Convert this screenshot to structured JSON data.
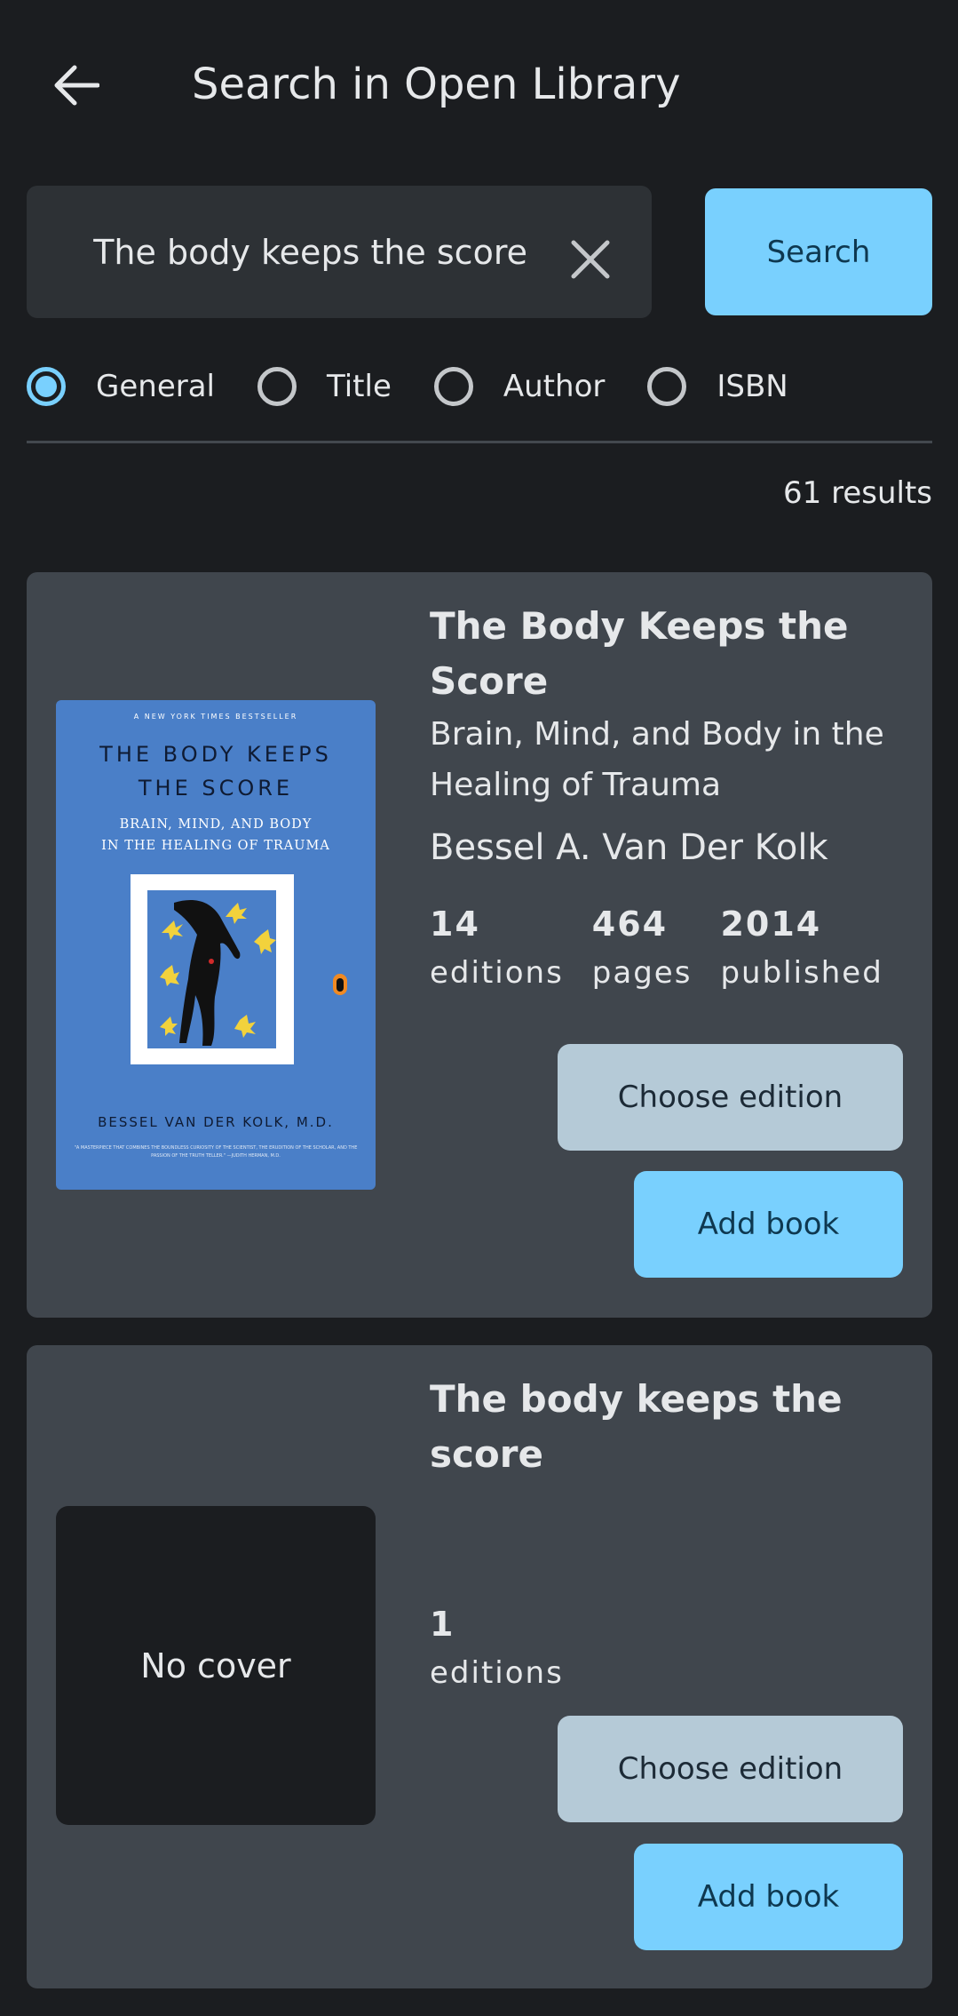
{
  "header": {
    "title": "Search in Open Library",
    "back_icon": "arrow-left-icon"
  },
  "search": {
    "value": "The body keeps the score",
    "placeholder": "",
    "clear_icon": "close-icon",
    "button_label": "Search"
  },
  "filters": {
    "selected": "General",
    "options": [
      {
        "label": "General",
        "checked": true
      },
      {
        "label": "Title",
        "checked": false
      },
      {
        "label": "Author",
        "checked": false
      },
      {
        "label": "ISBN",
        "checked": false
      }
    ]
  },
  "results": {
    "count_label": "61 results",
    "items": [
      {
        "title": "The Body Keeps the Score",
        "subtitle": "Brain, Mind, and Body in the Healing of Trauma",
        "author": "Bessel A. Van Der Kolk",
        "cover": {
          "has_cover": true,
          "top_line": "A NEW YORK TIMES BESTSELLER",
          "title": "THE BODY KEEPS THE SCORE",
          "subtitle": "BRAIN, MIND, AND BODY IN THE HEALING OF TRAUMA",
          "author": "BESSEL VAN DER KOLK, M.D.",
          "quote": "\"A MASTERPIECE THAT COMBINES THE BOUNDLESS CURIOSITY OF THE SCIENTIST, THE ERUDITION OF THE SCHOLAR, AND THE PASSION OF THE TRUTH TELLER.\" —JUDITH HERMAN, M.D."
        },
        "stats": [
          {
            "value": "14",
            "label": "editions"
          },
          {
            "value": "464",
            "label": "pages"
          },
          {
            "value": "2014",
            "label": "published"
          }
        ],
        "choose_edition_label": "Choose edition",
        "add_book_label": "Add book"
      },
      {
        "title": "The body keeps the score",
        "subtitle": "",
        "author": "",
        "cover": {
          "has_cover": false,
          "no_cover_label": "No cover"
        },
        "stats": [
          {
            "value": "1",
            "label": "editions"
          }
        ],
        "choose_edition_label": "Choose edition",
        "add_book_label": "Add book"
      }
    ]
  },
  "colors": {
    "background": "#1b1d20",
    "card": "#40464d",
    "accent": "#79d0fe",
    "secondary_button": "#b5cad7",
    "input_bg": "#2d3135"
  }
}
